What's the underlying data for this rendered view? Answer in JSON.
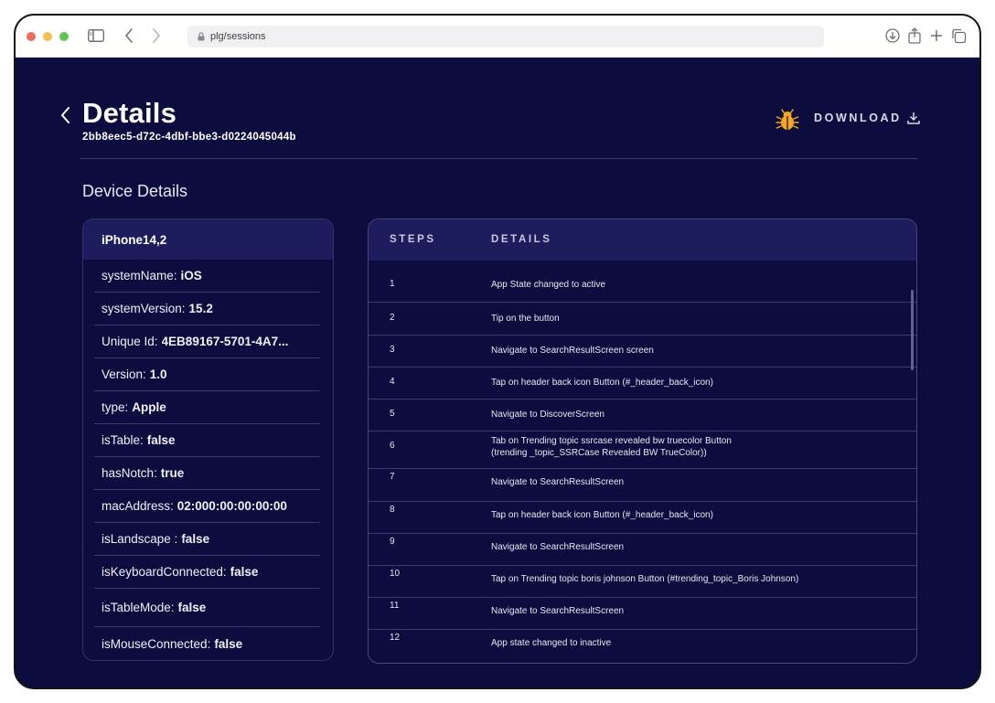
{
  "browser": {
    "address": "plg/sessions"
  },
  "page": {
    "title": "Details",
    "session_id": "2bb8eec5-d72c-4dbf-bbe3-d0224045044b",
    "download_label": "DOWNLOAD",
    "section_title": "Device Details"
  },
  "device": {
    "name": "iPhone14,2",
    "fields": [
      {
        "key": "systemName:",
        "value": "iOS"
      },
      {
        "key": "systemVersion:",
        "value": "15.2"
      },
      {
        "key": "Unique Id:",
        "value": "4EB89167-5701-4A7..."
      },
      {
        "key": "Version:",
        "value": "1.0"
      },
      {
        "key": "type:",
        "value": "Apple"
      },
      {
        "key": "isTable:",
        "value": "false"
      },
      {
        "key": "hasNotch:",
        "value": "true"
      },
      {
        "key": "macAddress:",
        "value": "02:000:00:00:00:00"
      },
      {
        "key": "isLandscape :",
        "value": "false"
      },
      {
        "key": "isKeyboardConnected:",
        "value": "false"
      },
      {
        "key": "isTableMode:",
        "value": "false"
      },
      {
        "key": "isMouseConnected:",
        "value": "false"
      }
    ]
  },
  "steps": {
    "header_steps": "STEPS",
    "header_details": "DETAILS",
    "rows": [
      {
        "num": "1",
        "text": "App State changed to active"
      },
      {
        "num": "2",
        "text": "Tip on the button"
      },
      {
        "num": "3",
        "text": "Navigate to SearchResultScreen screen"
      },
      {
        "num": "4",
        "text": "Tap on header back icon Button (#_header_back_icon)"
      },
      {
        "num": "5",
        "text": "Navigate to DiscoverScreen"
      },
      {
        "num": "6",
        "text": "Tab on Trending topic ssrcase revealed bw truecolor Button",
        "text2": "(trending _topic_SSRCase Revealed BW TrueColor))"
      },
      {
        "num": "7",
        "text": "Navigate to SearchResultScreen"
      },
      {
        "num": "8",
        "text": "Tap on header back icon Button (#_header_back_icon)"
      },
      {
        "num": "9",
        "text": "Navigate to SearchResultScreen"
      },
      {
        "num": "10",
        "text": "Tap on Trending topic boris johnson Button (#trending_topic_Boris Johnson)"
      },
      {
        "num": "11",
        "text": "Navigate to SearchResultScreen"
      },
      {
        "num": "12",
        "text": "App state changed to inactive"
      }
    ]
  },
  "colors": {
    "background": "#0d0c3e",
    "header_band": "#1d1c5c",
    "bug_icon": "#f5a623"
  }
}
